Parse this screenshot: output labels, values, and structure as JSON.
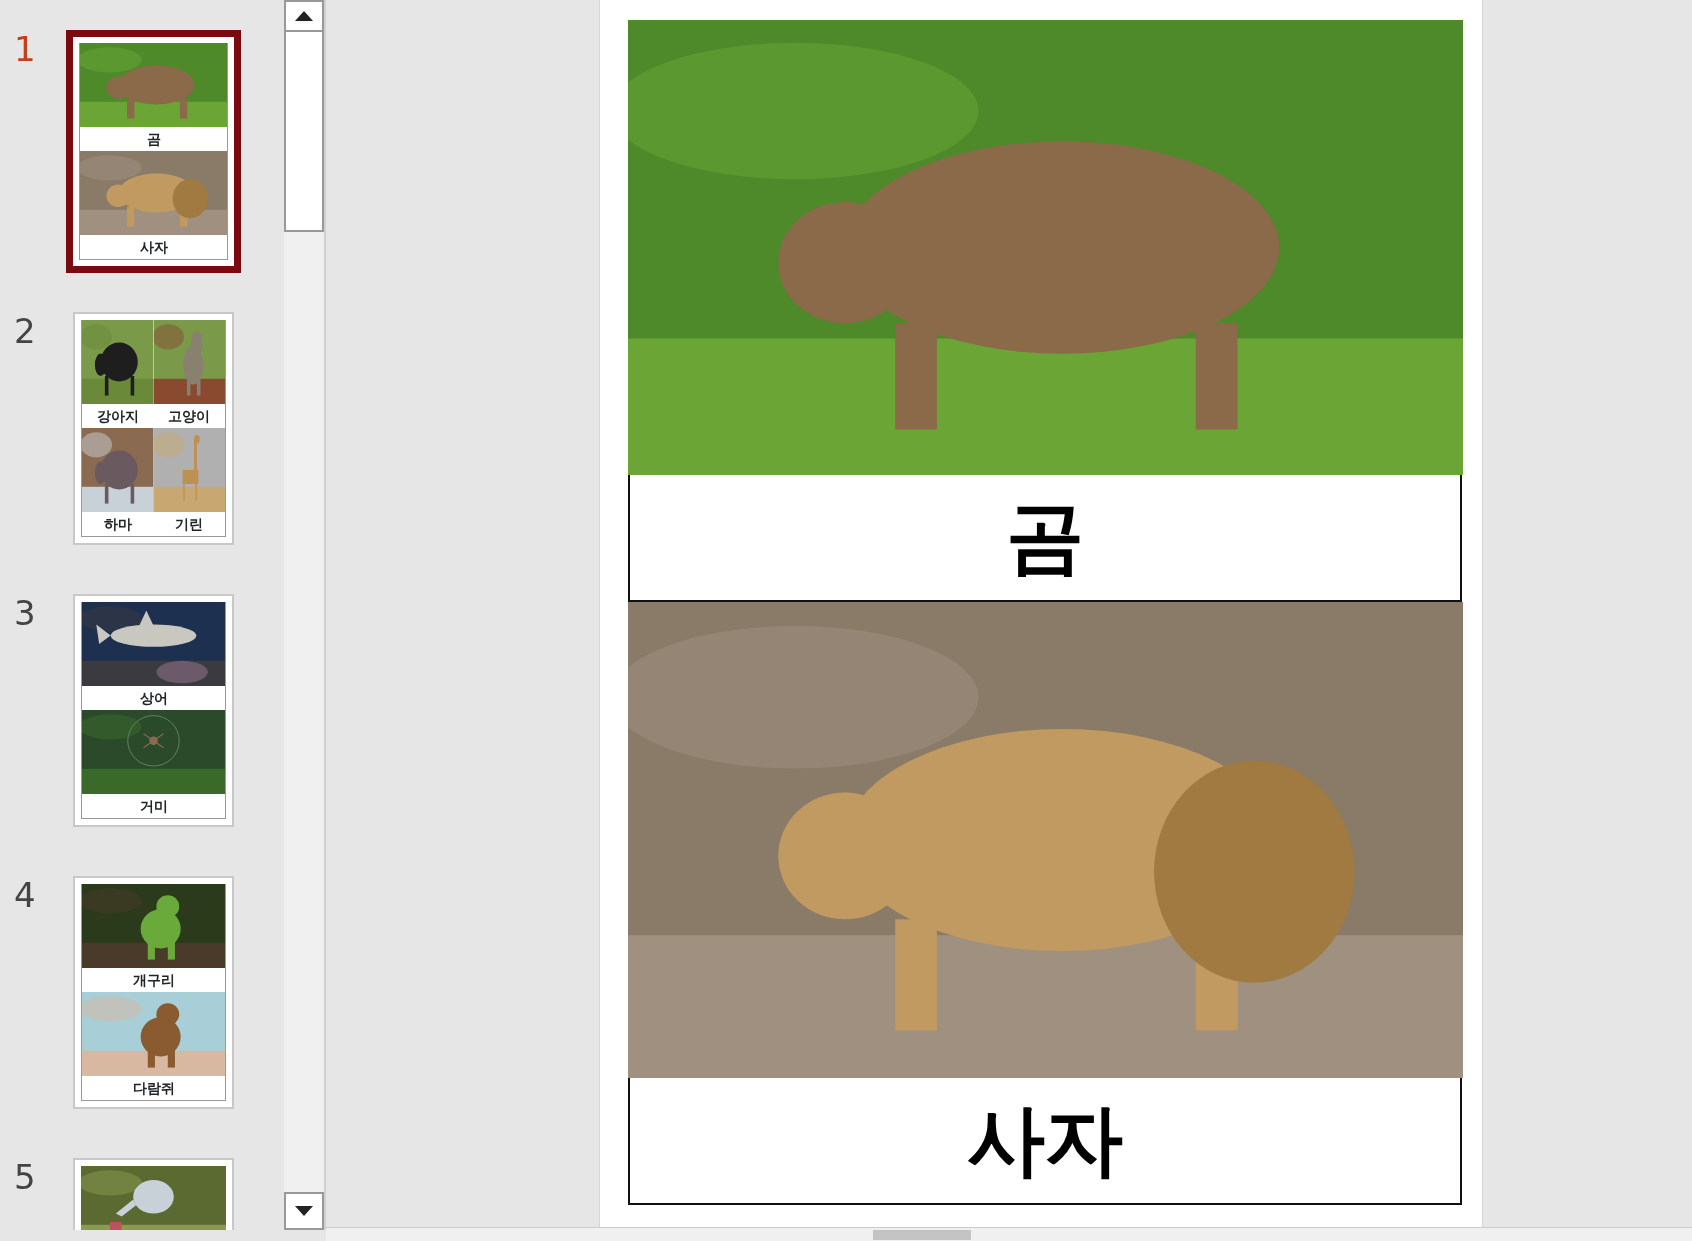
{
  "slides": [
    {
      "number": "1",
      "selected": true,
      "cards": [
        {
          "label": "곰"
        },
        {
          "label": "사자"
        }
      ]
    },
    {
      "number": "2",
      "selected": false,
      "cards": [
        {
          "label": "강아지"
        },
        {
          "label": "고양이"
        },
        {
          "label": "하마"
        },
        {
          "label": "기린"
        }
      ]
    },
    {
      "number": "3",
      "selected": false,
      "cards": [
        {
          "label": "상어"
        },
        {
          "label": "거미"
        }
      ]
    },
    {
      "number": "4",
      "selected": false,
      "cards": [
        {
          "label": "개구리"
        },
        {
          "label": "다람쥐"
        }
      ]
    },
    {
      "number": "5",
      "selected": false
    }
  ],
  "editor": {
    "cards": [
      {
        "label": "곰"
      },
      {
        "label": "사자"
      }
    ]
  }
}
